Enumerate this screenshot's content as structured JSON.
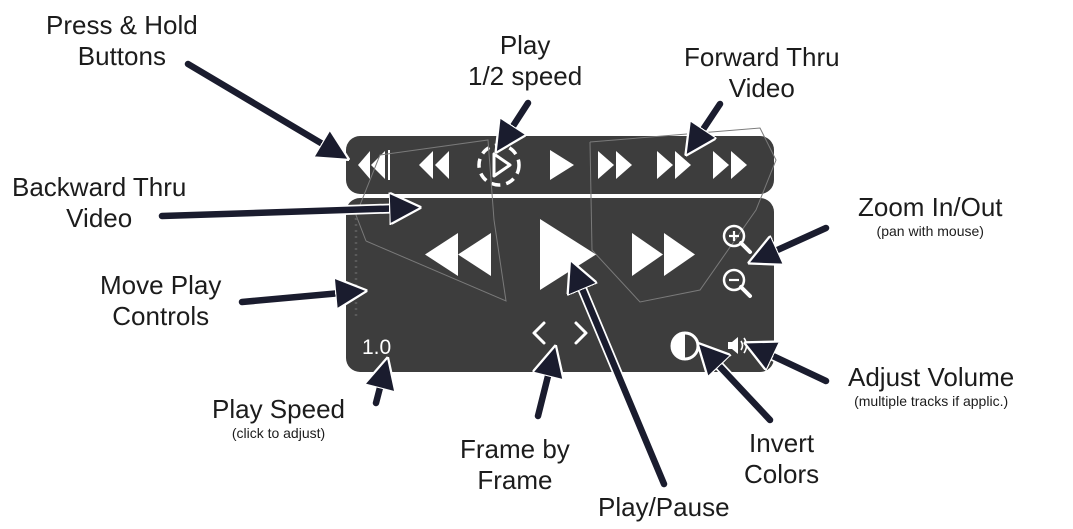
{
  "controls": {
    "play_speed_value": "1.0"
  },
  "callouts": {
    "press_hold_1": "Press & Hold",
    "press_hold_2": "Buttons",
    "play_half_1": "Play",
    "play_half_2": "1/2 speed",
    "forward_1": "Forward Thru",
    "forward_2": "Video",
    "backward_1": "Backward Thru",
    "backward_2": "Video",
    "zoom_title": "Zoom In/Out",
    "zoom_note": "(pan with mouse)",
    "move_1": "Move Play",
    "move_2": "Controls",
    "speed_title": "Play Speed",
    "speed_note": "(click to adjust)",
    "frame_1": "Frame by",
    "frame_2": "Frame",
    "playpause": "Play/Pause",
    "invert_1": "Invert",
    "invert_2": "Colors",
    "volume_title": "Adjust Volume",
    "volume_note": "(multiple tracks if applic.)"
  },
  "colors": {
    "panel": "#3d3d3d",
    "icon": "#ffffff",
    "arrow": "#1a1c2e",
    "arrow_outline": "#ffffff",
    "text": "#1c1c1c"
  },
  "icons": [
    "rewind-icon",
    "play-half-speed-icon",
    "play-icon",
    "fast-forward-icon",
    "zoom-in-icon",
    "zoom-out-icon",
    "frame-prev-icon",
    "frame-next-icon",
    "invert-colors-icon",
    "volume-icon",
    "move-handle-icon"
  ]
}
